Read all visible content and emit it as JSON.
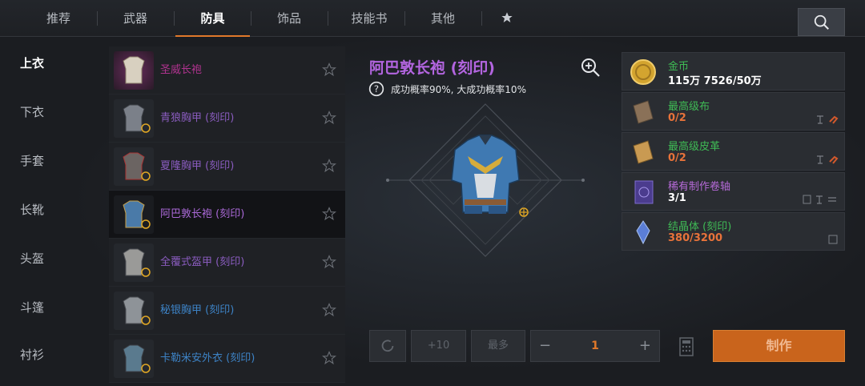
{
  "tabs": [
    "推荐",
    "武器",
    "防具",
    "饰品",
    "技能书",
    "其他"
  ],
  "active_tab": "防具",
  "categories": [
    "上衣",
    "下衣",
    "手套",
    "长靴",
    "头盔",
    "斗篷",
    "衬衫"
  ],
  "items": [
    {
      "name": "圣威长袍",
      "color": "#b0338f"
    },
    {
      "name": "青狼胸甲 (刻印)",
      "color": "#8a5cbf"
    },
    {
      "name": "夏隆胸甲 (刻印)",
      "color": "#8a5cbf"
    },
    {
      "name": "阿巴敦长袍 (刻印)",
      "color": "#a968d6"
    },
    {
      "name": "全覆式盔甲 (刻印)",
      "color": "#8a5cbf"
    },
    {
      "name": "秘银胸甲 (刻印)",
      "color": "#3d83c6"
    },
    {
      "name": "卡勒米安外衣 (刻印)",
      "color": "#3d83c6"
    }
  ],
  "detail": {
    "title": "阿巴敦长袍 (刻印)",
    "rate": "成功概率90%, 大成功概率10%"
  },
  "materials": [
    {
      "name": "金币",
      "count": "115万 7526/50万",
      "name_color": "green",
      "count_color": "white"
    },
    {
      "name": "最高级布",
      "count": "0/2",
      "name_color": "green",
      "count_color": "orange"
    },
    {
      "name": "最高级皮革",
      "count": "0/2",
      "name_color": "green",
      "count_color": "orange"
    },
    {
      "name": "稀有制作卷轴",
      "count": "3/1",
      "name_color": "purple",
      "count_color": "white"
    },
    {
      "name": "结晶体 (刻印)",
      "count": "380/3200",
      "name_color": "green",
      "count_color": "orange"
    }
  ],
  "controls": {
    "plus10": "+10",
    "max": "最多",
    "minus": "−",
    "plus": "+",
    "quantity": "1",
    "craft": "制作"
  },
  "colors": {
    "accent": "#e0792a",
    "craft": "#c9641c"
  }
}
